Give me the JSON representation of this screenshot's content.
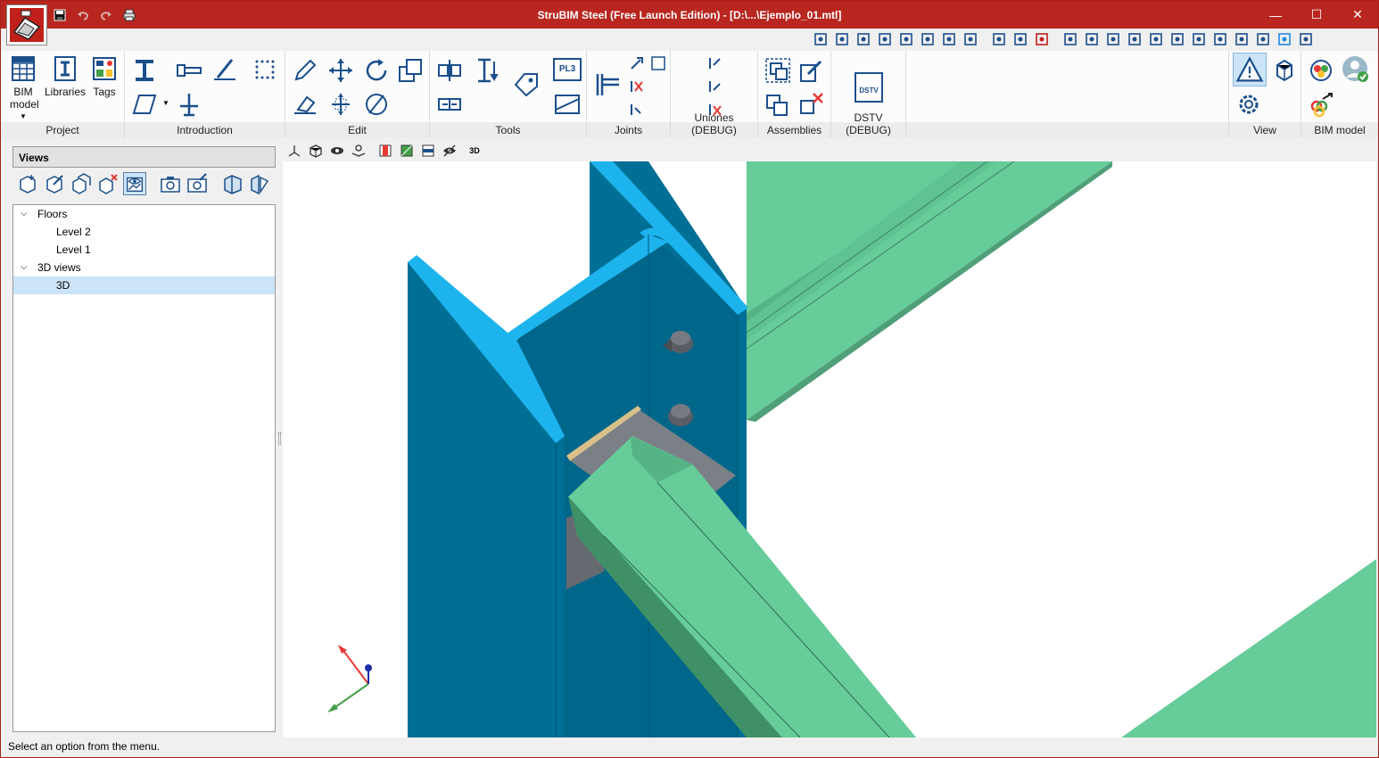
{
  "window": {
    "title": "StruBIM Steel (Free Launch Edition) - [D:\\...\\Ejemplo_01.mtl]",
    "minimize": "—",
    "maximize": "☐",
    "close": "✕"
  },
  "ribbon": {
    "groups": {
      "project": "Project",
      "introduction": "Introduction",
      "edit": "Edit",
      "tools": "Tools",
      "joints": "Joints",
      "uniones": "Uniones (DEBUG)",
      "assemblies": "Assemblies",
      "dstv": "DSTV (DEBUG)",
      "view": "View",
      "bim": "BIM model"
    },
    "buttons": {
      "bim_model": "BIM model",
      "libraries": "Libraries",
      "tags": "Tags",
      "pl3": "PL3",
      "dstv": "DSTV"
    }
  },
  "views_panel": {
    "title": "Views",
    "tree": [
      {
        "label": "Floors",
        "level": 0,
        "expanded": true
      },
      {
        "label": "Level 2",
        "level": 1
      },
      {
        "label": "Level 1",
        "level": 1
      },
      {
        "label": "3D views",
        "level": 0,
        "expanded": true
      },
      {
        "label": "3D",
        "level": 1,
        "selected": true
      }
    ]
  },
  "viewport_toolbar": {
    "label_3d": "3D"
  },
  "status": {
    "text": "Select an option from the menu."
  },
  "colors": {
    "titlebar": "#b8261f",
    "column": "#006f95",
    "column_cut": "#1db4ee",
    "beam": "#66cc99",
    "beam_dark": "#3f9067",
    "plate": "#7b8087",
    "selection": "#cce4f7"
  }
}
